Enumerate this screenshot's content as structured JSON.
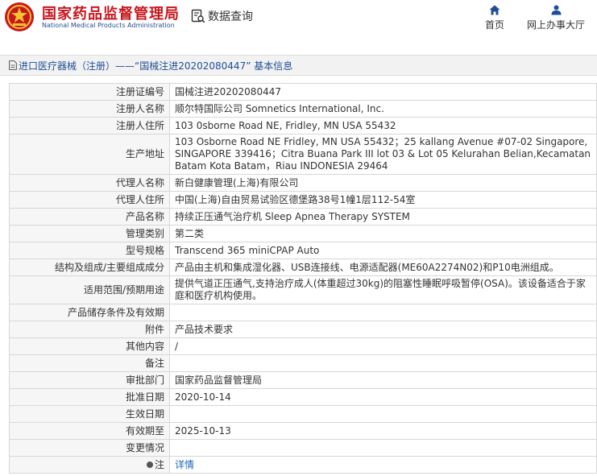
{
  "header": {
    "agency_name_cn": "国家药品监督管理局",
    "agency_name_en": "National Medical Products Administration",
    "query_label": "数据查询",
    "nav": {
      "home_label": "首页",
      "online_label": "网上办事大厅"
    },
    "colors": {
      "brand_red": "#c8161d",
      "brand_blue": "#1f4e96"
    }
  },
  "breadcrumb": {
    "text": "进口医疗器械（注册）——“国械注进20202080447” 基本信息"
  },
  "details": {
    "registration_no": {
      "label": "注册证编号",
      "value": "国械注进20202080447"
    },
    "registrant_name": {
      "label": "注册人名称",
      "value": "顺尔特国际公司 Somnetics International, Inc."
    },
    "registrant_address": {
      "label": "注册人住所",
      "value": "103 0sborne Road NE, Fridley, MN USA 55432"
    },
    "production_address": {
      "label": "生产地址",
      "value": "103 Osborne Road NE Fridley, MN USA 55432；25 kallang Avenue #07-02 Singapore, SINGAPORE 339416；Citra Buana Park III lot 03 & Lot 05 Kelurahan Belian,Kecamatan Batam Kota Batam，Riau INDONESIA 29464"
    },
    "agent_name": {
      "label": "代理人名称",
      "value": "新白健康管理(上海)有限公司"
    },
    "agent_address": {
      "label": "代理人住所",
      "value": "中国(上海)自由贸易试验区德堡路38号1幢1层112-54室"
    },
    "product_name": {
      "label": "产品名称",
      "value": "持续正压通气治疗机 Sleep Apnea Therapy SYSTEM"
    },
    "management_class": {
      "label": "管理类别",
      "value": "第二类"
    },
    "model_spec": {
      "label": "型号规格",
      "value": "Transcend 365 miniCPAP Auto"
    },
    "structure": {
      "label": "结构及组成/主要组成成分",
      "value": "产品由主机和集成湿化器、USB连接线、电源适配器(ME60A2274N02)和P10电洲组成。"
    },
    "intended_use": {
      "label": "适用范围/预期用途",
      "value": "提供气道正压通气,支持治疗成人(体重超过30kg)的阻塞性睡眠呼吸暂停(OSA)。该设备适合于家庭和医疗机构使用。"
    },
    "storage": {
      "label": "产品储存条件及有效期",
      "value": ""
    },
    "attachment": {
      "label": "附件",
      "value": "产品技术要求"
    },
    "other": {
      "label": "其他内容",
      "value": "/"
    },
    "remarks": {
      "label": "备注",
      "value": ""
    },
    "approval_dept": {
      "label": "审批部门",
      "value": "国家药品监督管理局"
    },
    "approval_date": {
      "label": "批准日期",
      "value": "2020-10-14"
    },
    "effective_date": {
      "label": "生效日期",
      "value": ""
    },
    "valid_until": {
      "label": "有效期至",
      "value": "2025-10-13"
    },
    "changes": {
      "label": "变更情况",
      "value": ""
    },
    "note": {
      "label": "注",
      "value": "详情"
    }
  }
}
